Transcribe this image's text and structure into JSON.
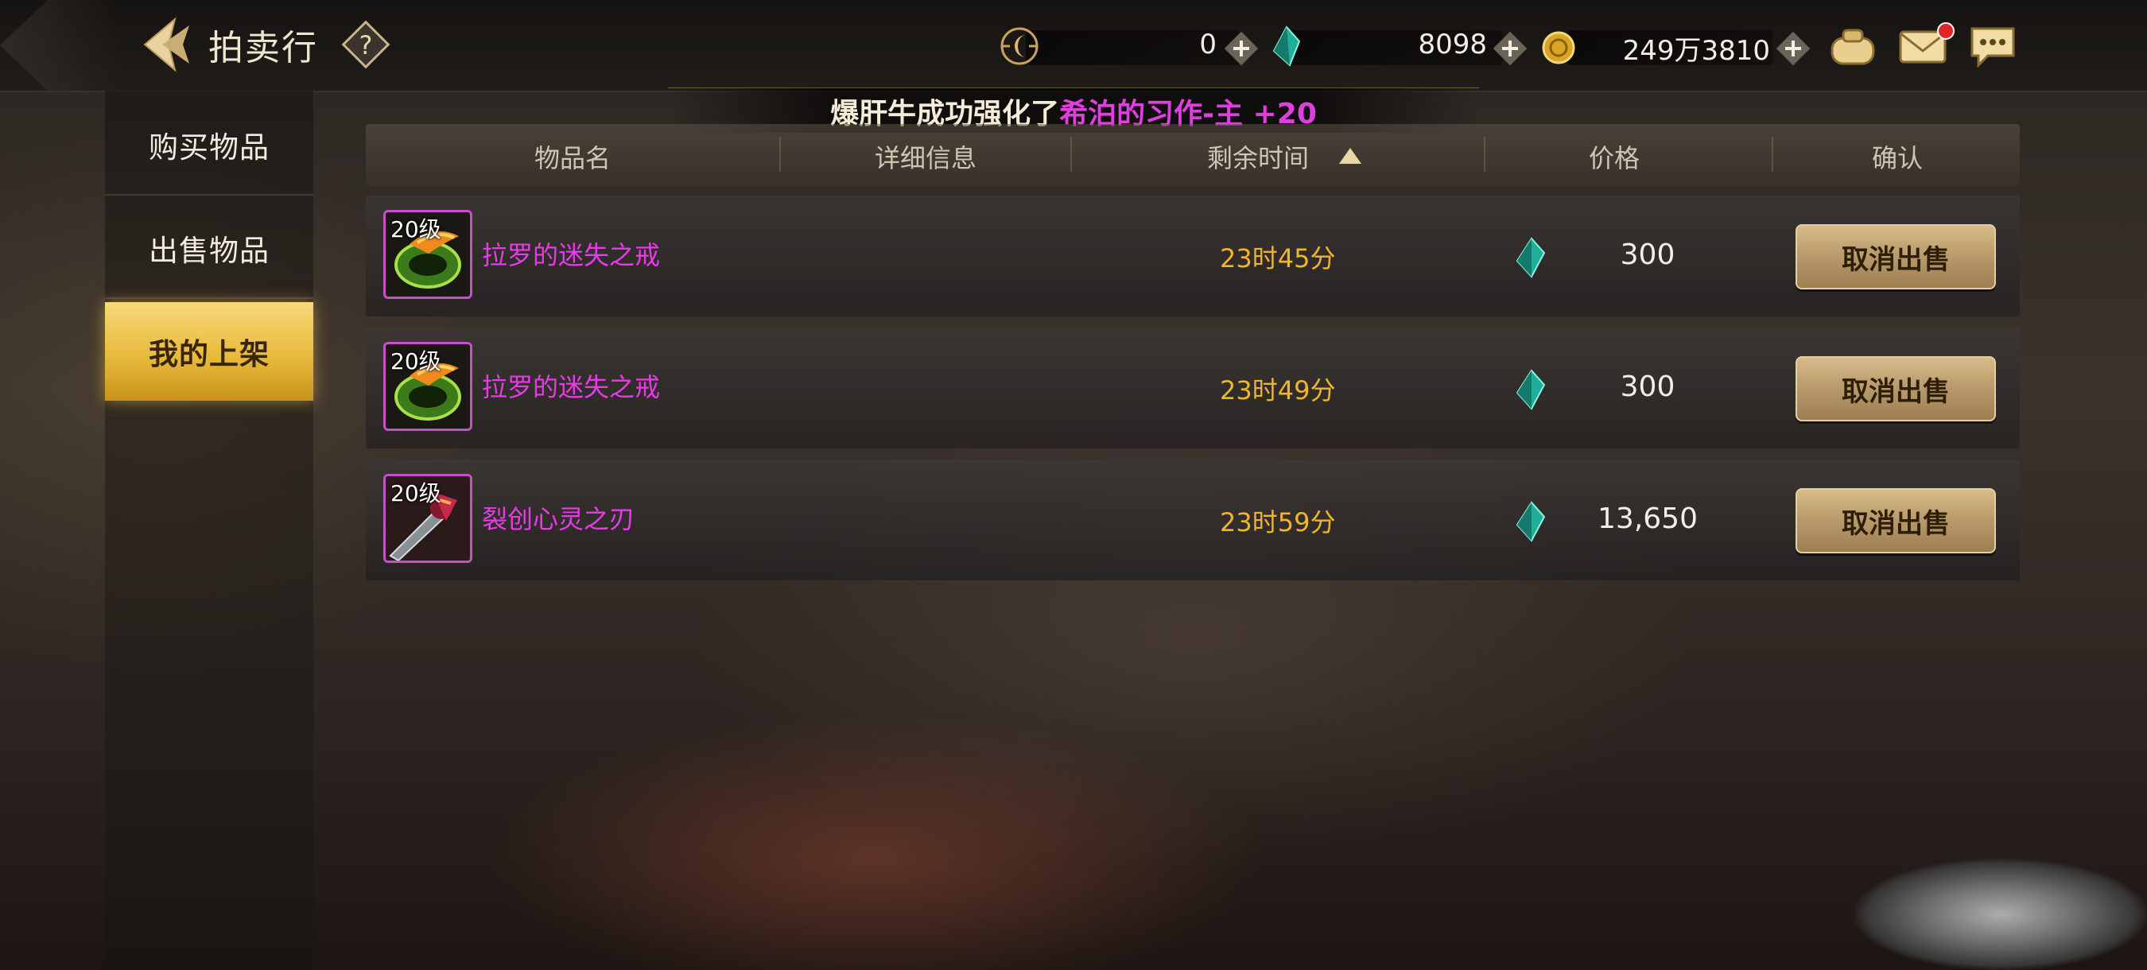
{
  "header": {
    "title": "拍卖行",
    "currencies": [
      {
        "icon": "crescent-coin-icon",
        "value": "0"
      },
      {
        "icon": "green-gem-icon",
        "value": "8098"
      },
      {
        "icon": "gold-coin-icon",
        "value": "249万3810"
      }
    ],
    "icons": [
      "purse-icon",
      "mail-icon",
      "chat-icon"
    ]
  },
  "sidebar": {
    "items": [
      {
        "label": "购买物品",
        "active": false
      },
      {
        "label": "出售物品",
        "active": false
      },
      {
        "label": "我的上架",
        "active": true
      }
    ]
  },
  "notice": {
    "prefix": "爆肝牛成功强化了",
    "highlight": "希泊的习作-主 +20"
  },
  "table": {
    "columns": [
      "物品名",
      "详细信息",
      "剩余时间",
      "价格",
      "确认"
    ],
    "sort_column": "剩余时间",
    "sort_direction": "ascending",
    "rows": [
      {
        "level": "20级",
        "name": "拉罗的迷失之戒",
        "time": "23时45分",
        "price": "300",
        "action": "取消出售",
        "item_icon": "ring-icon"
      },
      {
        "level": "20级",
        "name": "拉罗的迷失之戒",
        "time": "23时49分",
        "price": "300",
        "action": "取消出售",
        "item_icon": "ring-icon"
      },
      {
        "level": "20级",
        "name": "裂创心灵之刃",
        "time": "23时59分",
        "price": "13,650",
        "action": "取消出售",
        "item_icon": "blade-icon"
      }
    ]
  },
  "colors": {
    "item_name": "#e83be8",
    "time": "#f1b52a",
    "active_tab": "#e8bb3c",
    "button": "#b8996a"
  }
}
